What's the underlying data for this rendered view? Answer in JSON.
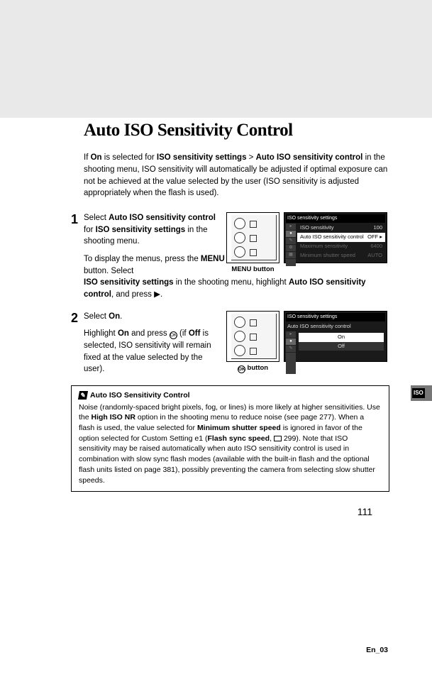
{
  "heading": "Auto ISO Sensitivity Control",
  "intro": {
    "p1a": "If ",
    "on": "On",
    "p1b": " is selected for ",
    "iso_settings": "ISO sensitivity settings",
    "gt": " > ",
    "auto_ctrl": "Auto ISO sensitivity control",
    "p1c": " in the shooting menu, ISO sensitivity will automatically be adjusted if optimal exposure can not be achieved at the value selected by the user (ISO sensitivity is adjusted appropriately when the flash is used)."
  },
  "step1": {
    "num": "1",
    "t1": "Select ",
    "t2": "Auto ISO sensitivity control",
    "t3": " for ",
    "t4": "ISO sensitivity settings",
    "t5": " in the shooting menu.",
    "b1": "To display the menus, press the ",
    "menu": "MENU",
    "b2": " button.  Select ",
    "b3": "ISO sensitivity settings",
    "b4": " in the shooting menu, highlight ",
    "b5": "Auto ISO sensitivity control",
    "b6": ", and press ",
    "arrow": "▶",
    "b7": ".",
    "caption": "MENU button",
    "lcd": {
      "title": "ISO sensitivity settings",
      "r1a": "ISO sensitivity",
      "r1b": "100",
      "r2a": "Auto ISO sensitivity control",
      "r2b": "OFF ▸",
      "r3a": "Maximum sensitivity",
      "r3b": "6400",
      "r4a": "Minimum shutter speed",
      "r4b": "AUTO"
    }
  },
  "step2": {
    "num": "2",
    "t1": "Select ",
    "t2": "On",
    "t3": ".",
    "b1": "Highlight ",
    "b2": "On",
    "b3": " and press ",
    "b4": " (if ",
    "b5": "Off",
    "b6": " is selected, ISO sensitivity will remain fixed at the value selected by the user).",
    "caption_btn": " button",
    "lcd": {
      "title1": "ISO sensitivity settings",
      "title2": "Auto ISO sensitivity control",
      "on": "On",
      "off": "Off"
    }
  },
  "note": {
    "title": "Auto ISO Sensitivity Control",
    "p1": "Noise (randomly-spaced bright pixels, fog, or lines) is more likely at higher sensitivities.  Use the ",
    "hiiso": "High ISO NR",
    "p2": " option in the shooting menu to reduce noise (see page 277).  When a flash is used, the value selected for ",
    "minss": "Minimum shutter speed",
    "p3": " is ignored in favor of the option selected for Custom Setting e1 (",
    "flash": "Flash sync speed",
    "p4": ", ",
    "ref": " 299). Note that ISO sensitivity may be raised automatically when auto ISO sensitivity control is used in combination with slow sync flash modes (available with the built-in flash and the optional flash units listed on page 381), possibly preventing the camera from selecting slow shutter speeds."
  },
  "page_num": "111",
  "footer": "En_03",
  "side_iso": "ISO"
}
